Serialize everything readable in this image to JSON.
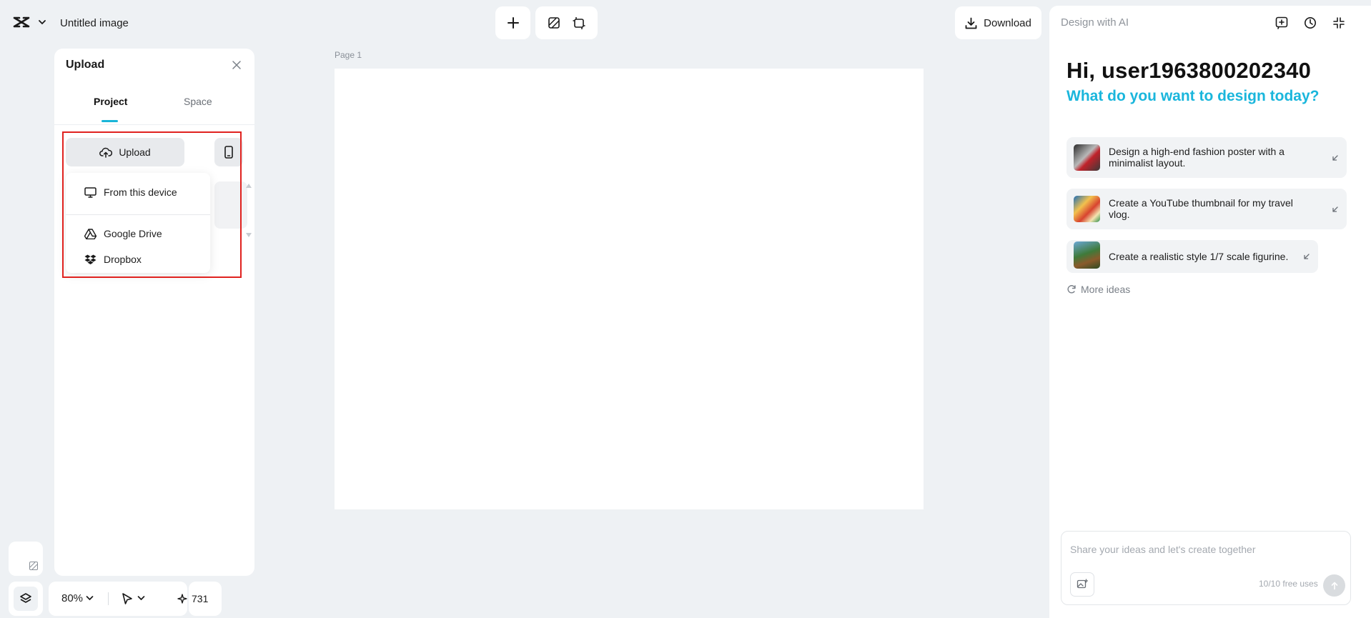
{
  "header": {
    "document_title": "Untitled image",
    "download_label": "Download"
  },
  "upload_panel": {
    "title": "Upload",
    "tabs": [
      {
        "label": "Project",
        "active": true
      },
      {
        "label": "Space",
        "active": false
      }
    ],
    "upload_button_label": "Upload",
    "menu_items": [
      {
        "label": "From this device",
        "icon": "monitor-icon"
      },
      {
        "label": "Google Drive",
        "icon": "google-drive-icon"
      },
      {
        "label": "Dropbox",
        "icon": "dropbox-icon"
      }
    ]
  },
  "canvas": {
    "page_label": "Page 1"
  },
  "bottom_bar": {
    "zoom": "80%",
    "credits": "731"
  },
  "ai_panel": {
    "title": "Design with AI",
    "greeting": "Hi, user1963800202340",
    "question": "What do you want to design today?",
    "suggestions": [
      {
        "text_line1": "Design a high-end fashion poster with a",
        "text_line2": "minimalist layout."
      },
      {
        "text_line1": "Create a YouTube thumbnail for my travel",
        "text_line2": "vlog."
      },
      {
        "text_line1": "Create a realistic style 1/7 scale figurine.",
        "text_line2": ""
      }
    ],
    "more_ideas_label": "More ideas",
    "chat_placeholder": "Share your ideas and let's create together",
    "free_uses": "10/10 free uses"
  },
  "colors": {
    "accent": "#19b5d8",
    "highlight_border": "#e0221f",
    "background": "#eef1f4"
  }
}
